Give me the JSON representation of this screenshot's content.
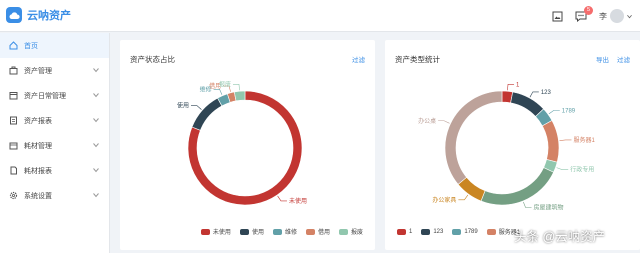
{
  "app": {
    "title": "云呐资产"
  },
  "header": {
    "user_name": "李",
    "notification_count": "5"
  },
  "sidebar": {
    "items": [
      {
        "label": "首页"
      },
      {
        "label": "资产管理"
      },
      {
        "label": "资产日常管理"
      },
      {
        "label": "资产报表"
      },
      {
        "label": "耗材管理"
      },
      {
        "label": "耗材报表"
      },
      {
        "label": "系统设置"
      }
    ]
  },
  "status_card": {
    "title": "资产状态占比",
    "filter_label": "过滤"
  },
  "type_card": {
    "title": "资产类型统计",
    "export_label": "导出",
    "filter_label": "过滤"
  },
  "watermark": "头条 @云呐资产",
  "chart_data": [
    {
      "type": "pie",
      "title": "资产状态占比",
      "series": [
        {
          "name": "未使用",
          "value": 81,
          "color": "#c23531"
        },
        {
          "name": "使用",
          "value": 11,
          "color": "#2f4554"
        },
        {
          "name": "维修",
          "value": 3,
          "color": "#61a0a8"
        },
        {
          "name": "借用",
          "value": 2,
          "color": "#d48265"
        },
        {
          "name": "报废",
          "value": 3,
          "color": "#91c7ae"
        }
      ],
      "legend": "bottom"
    },
    {
      "type": "pie",
      "title": "资产类型统计",
      "series": [
        {
          "name": "1",
          "value": 3,
          "color": "#c23531"
        },
        {
          "name": "123",
          "value": 10,
          "color": "#2f4554"
        },
        {
          "name": "1789",
          "value": 4,
          "color": "#61a0a8"
        },
        {
          "name": "服务器1",
          "value": 12,
          "color": "#d48265"
        },
        {
          "name": "行政专用",
          "value": 3,
          "color": "#91c7ae"
        },
        {
          "name": "房屋建筑物",
          "value": 24,
          "color": "#749f83"
        },
        {
          "name": "办公家具",
          "value": 8,
          "color": "#ca8622"
        },
        {
          "name": "办公桌",
          "value": 36,
          "color": "#bda29a"
        }
      ],
      "legend": "bottom"
    }
  ]
}
